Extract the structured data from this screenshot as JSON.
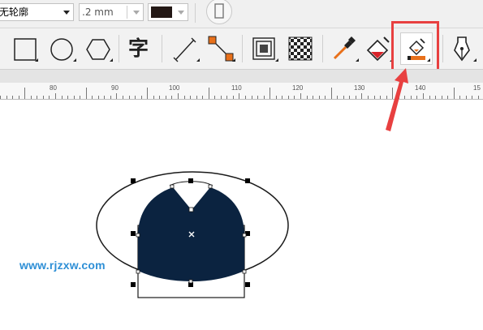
{
  "property_bar": {
    "outline_style_label": "无轮廓",
    "outline_width_value": ".2 mm"
  },
  "toolbar": {
    "tools": [
      {
        "id": "rectangle",
        "icon": "rectangle-icon"
      },
      {
        "id": "ellipse",
        "icon": "ellipse-icon"
      },
      {
        "id": "polygon",
        "icon": "hexagon-icon"
      },
      {
        "id": "text",
        "icon": "text-icon",
        "glyph": "字"
      },
      {
        "id": "dimension",
        "icon": "dimension-line-icon"
      },
      {
        "id": "connector",
        "icon": "connector-icon"
      },
      {
        "id": "contour",
        "icon": "contour-icon"
      },
      {
        "id": "transparency",
        "icon": "checkerboard-icon"
      },
      {
        "id": "eyedropper",
        "icon": "eyedropper-icon"
      },
      {
        "id": "interactive-fill",
        "icon": "fill-bucket-icon"
      },
      {
        "id": "smart-fill",
        "icon": "smart-fill-icon"
      },
      {
        "id": "pen",
        "icon": "pen-nib-icon"
      }
    ]
  },
  "ruler": {
    "labels": [
      "80",
      "90",
      "100",
      "110",
      "120",
      "130",
      "140",
      "15"
    ]
  },
  "canvas": {
    "shape_fill_color": "#0b2340",
    "outline_color": "#1a1a1a"
  },
  "watermark": "www.rjzxw.com",
  "colors": {
    "highlight": "#e84040",
    "accent_orange": "#e8701a"
  }
}
